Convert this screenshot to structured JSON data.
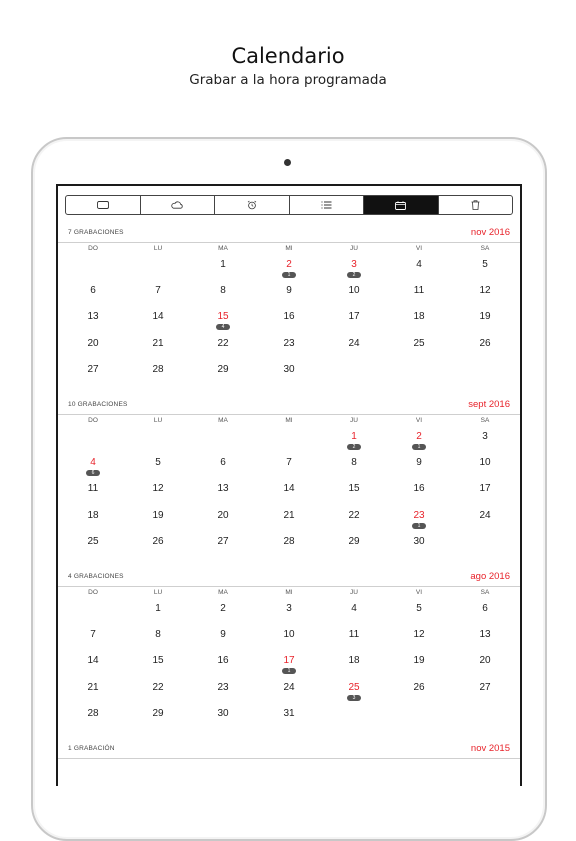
{
  "header": {
    "title": "Calendario",
    "subtitle": "Grabar a la hora programada"
  },
  "toolbar": {
    "tabs": [
      {
        "icon": "tv-icon",
        "active": false
      },
      {
        "icon": "cloud-icon",
        "active": false
      },
      {
        "icon": "alarm-clock-icon",
        "active": false
      },
      {
        "icon": "list-icon",
        "active": false
      },
      {
        "icon": "calendar-icon",
        "active": true
      },
      {
        "icon": "trash-icon",
        "active": false
      }
    ]
  },
  "weekdays": [
    "DO",
    "LU",
    "MA",
    "MI",
    "JU",
    "VI",
    "SA"
  ],
  "months": [
    {
      "count": "7 GRABACIONES",
      "name": "nov 2016",
      "first_weekday": 2,
      "days_in_month": 30,
      "recordings": [
        {
          "day": 2,
          "count": "1"
        },
        {
          "day": 3,
          "count": "2"
        },
        {
          "day": 15,
          "count": "4"
        }
      ]
    },
    {
      "count": "10 GRABACIONES",
      "name": "sept 2016",
      "first_weekday": 4,
      "days_in_month": 30,
      "recordings": [
        {
          "day": 1,
          "count": "2"
        },
        {
          "day": 2,
          "count": "1"
        },
        {
          "day": 4,
          "count": "6"
        },
        {
          "day": 23,
          "count": "1"
        }
      ]
    },
    {
      "count": "4 GRABACIONES",
      "name": "ago 2016",
      "first_weekday": 1,
      "days_in_month": 31,
      "recordings": [
        {
          "day": 17,
          "count": "1"
        },
        {
          "day": 25,
          "count": "3"
        }
      ]
    },
    {
      "count": "1 GRABACIÓN",
      "name": "nov 2015",
      "first_weekday": 0,
      "days_in_month": 0,
      "recordings": []
    }
  ],
  "colors": {
    "accent": "#e8232b",
    "badge": "#555555",
    "active_tab": "#111111"
  }
}
